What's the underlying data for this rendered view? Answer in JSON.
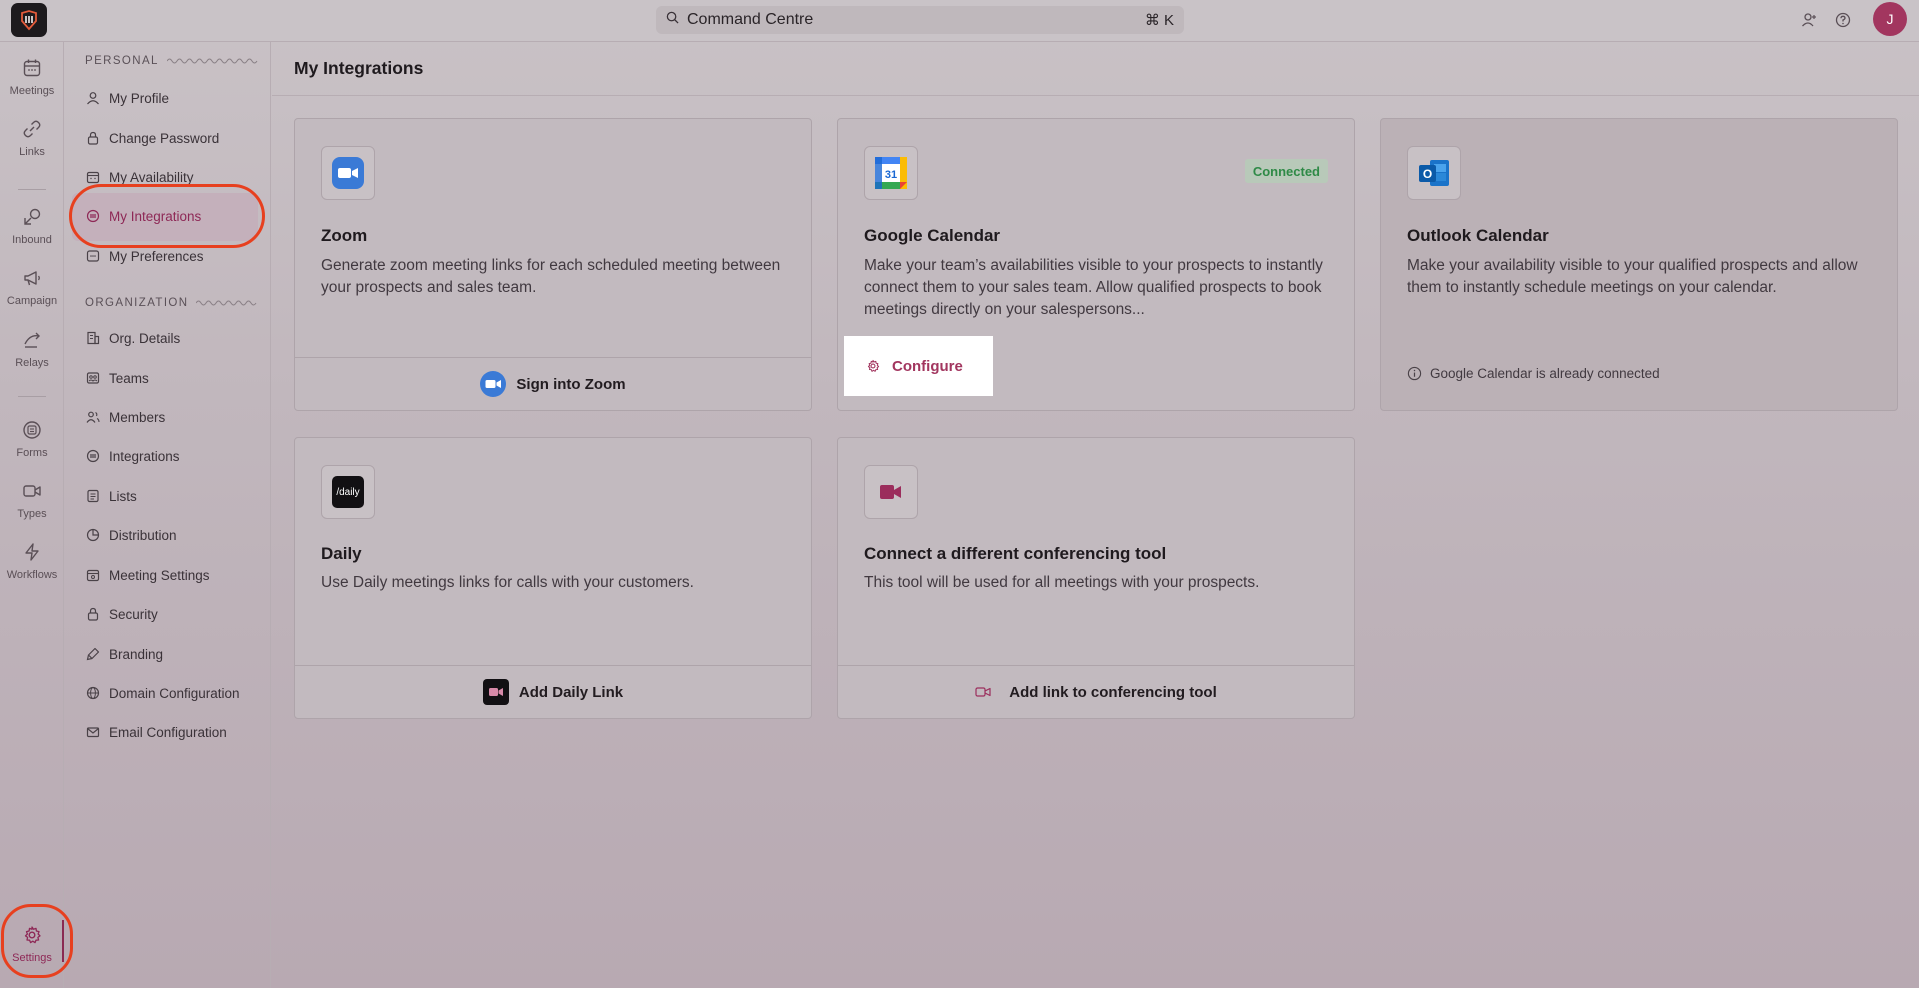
{
  "topbar": {
    "search_label": "Command Centre",
    "shortcut": "⌘ K",
    "avatar_initial": "J"
  },
  "rail": {
    "items": [
      {
        "label": "Meetings",
        "icon": "calendar-icon"
      },
      {
        "label": "Links",
        "icon": "link-icon"
      },
      {
        "label": "Inbound",
        "icon": "inbound-icon"
      },
      {
        "label": "Campaign",
        "icon": "megaphone-icon"
      },
      {
        "label": "Relays",
        "icon": "relay-icon"
      },
      {
        "label": "Forms",
        "icon": "form-icon"
      },
      {
        "label": "Types",
        "icon": "video-icon"
      },
      {
        "label": "Workflows",
        "icon": "lightning-icon"
      },
      {
        "label": "Settings",
        "icon": "gear-icon"
      }
    ]
  },
  "sidebar": {
    "personal_title": "PERSONAL",
    "organization_title": "ORGANIZATION",
    "personal": [
      {
        "label": "My Profile"
      },
      {
        "label": "Change Password"
      },
      {
        "label": "My Availability"
      },
      {
        "label": "My Integrations"
      },
      {
        "label": "My Preferences"
      }
    ],
    "organization": [
      {
        "label": "Org. Details"
      },
      {
        "label": "Teams"
      },
      {
        "label": "Members"
      },
      {
        "label": "Integrations"
      },
      {
        "label": "Lists"
      },
      {
        "label": "Distribution"
      },
      {
        "label": "Meeting Settings"
      },
      {
        "label": "Security"
      },
      {
        "label": "Branding"
      },
      {
        "label": "Domain Configuration"
      },
      {
        "label": "Email Configuration"
      }
    ]
  },
  "main": {
    "title": "My Integrations",
    "cards": {
      "zoom": {
        "title": "Zoom",
        "desc": "Generate zoom meeting links for each scheduled meeting between your prospects and sales team.",
        "action": "Sign into Zoom"
      },
      "gcal": {
        "title": "Google Calendar",
        "desc": "Make your team’s availabilities visible to your prospects to instantly connect them to your sales team. Allow qualified prospects to book meetings directly on your salespersons...",
        "badge": "Connected",
        "action": "Configure",
        "icon_text": "31"
      },
      "outlook": {
        "title": "Outlook Calendar",
        "desc": "Make your availability visible to your qualified prospects and allow them to instantly schedule meetings on your calendar.",
        "note": "Google Calendar is already connected",
        "icon_text": "O"
      },
      "daily": {
        "title": "Daily",
        "desc": "Use Daily meetings links for calls with your customers.",
        "action": "Add Daily Link",
        "icon_text": "/daily"
      },
      "other": {
        "title": "Connect a different conferencing tool",
        "desc": "This tool will be used for all meetings with your prospects.",
        "action": "Add link to conferencing tool"
      }
    }
  },
  "colors": {
    "accent": "#a2365f",
    "highlight_ring": "#e7401f",
    "connected": "#2f8a47"
  }
}
